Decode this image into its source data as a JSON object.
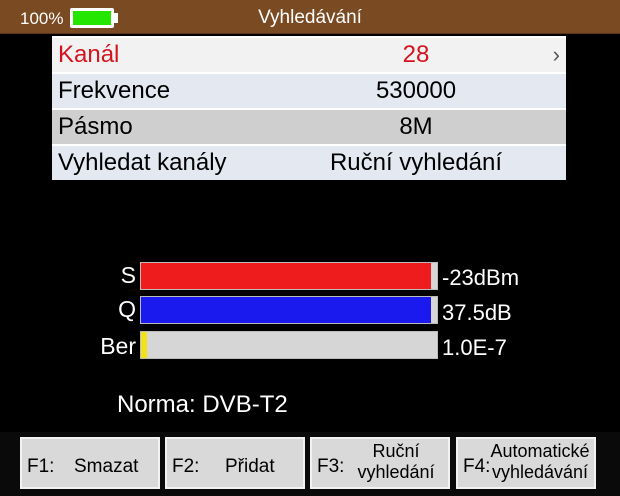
{
  "status_bar": {
    "battery_percent_label": "100%",
    "battery_level": 1.0,
    "battery_color": "#25e600",
    "title": "Vyhledávání"
  },
  "settings": {
    "rows": [
      {
        "label": "Kanál",
        "value": "28",
        "has_chevron": true
      },
      {
        "label": "Frekvence",
        "value": "530000"
      },
      {
        "label": "Pásmo",
        "value": "8M"
      },
      {
        "label": "Vyhledat kanály",
        "value": "Ruční vyhledání"
      }
    ],
    "chevron": "›",
    "selected_color": "#d4141f"
  },
  "meters": [
    {
      "label": "S",
      "value": "-23dBm",
      "fill_fraction": 0.98,
      "color": "#ee1c1c"
    },
    {
      "label": "Q",
      "value": "37.5dB",
      "fill_fraction": 0.98,
      "color": "#1a1aee"
    },
    {
      "label": "Ber",
      "value": "1.0E-7",
      "fill_fraction": 0.02,
      "color": "#f2e21a"
    }
  ],
  "norma": "Norma: DVB-T2",
  "function_keys": [
    {
      "id": "F1:",
      "label": "Smazat"
    },
    {
      "id": "F2:",
      "label": "Přidat"
    },
    {
      "id": "F3:",
      "label_line1": "Ruční",
      "label_line2": "vyhledání"
    },
    {
      "id": "F4:",
      "label_line1": "Automatické",
      "label_line2": "vyhledávání"
    }
  ]
}
